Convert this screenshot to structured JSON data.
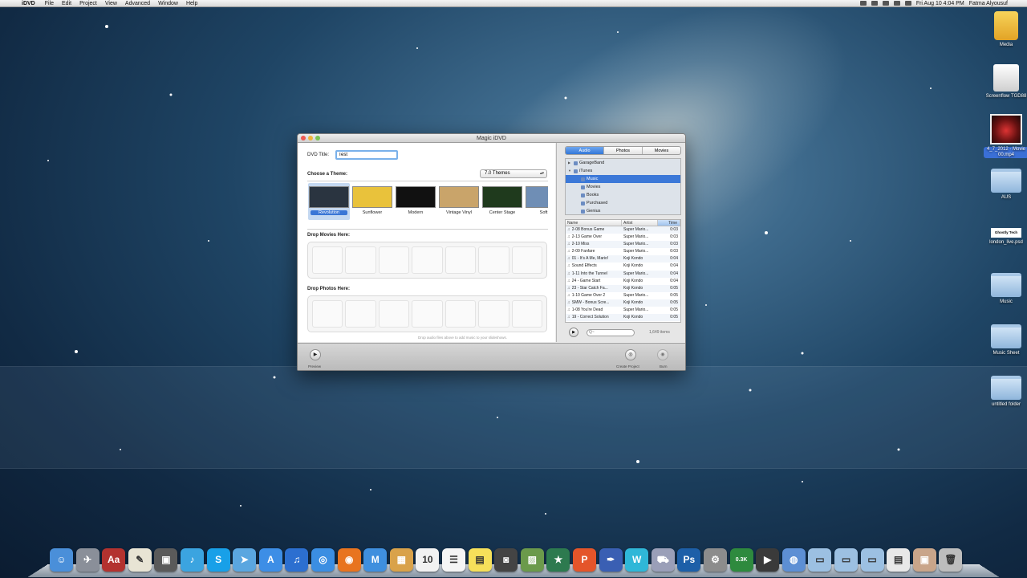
{
  "menubar": {
    "app_name": "iDVD",
    "menus": [
      "File",
      "Edit",
      "Project",
      "View",
      "Advanced",
      "Window",
      "Help"
    ],
    "clock": "Fri Aug 10  4:04 PM",
    "user": "Fatma Alyousuf"
  },
  "window": {
    "title": "Magic iDVD",
    "dvd_title_label": "DVD Title:",
    "dvd_title_value": "Test",
    "choose_theme_label": "Choose a Theme:",
    "themes_family": "7.0 Themes",
    "themes": [
      {
        "name": "Revolution",
        "selected": true,
        "color": "#2a3440"
      },
      {
        "name": "Sunflower",
        "selected": false,
        "color": "#e9c23b"
      },
      {
        "name": "Modern",
        "selected": false,
        "color": "#111111"
      },
      {
        "name": "Vintage Vinyl",
        "selected": false,
        "color": "#c9a46a"
      },
      {
        "name": "Center Stage",
        "selected": false,
        "color": "#1f3a1d"
      },
      {
        "name": "Soft F",
        "selected": false,
        "color": "#6f8eb5"
      }
    ],
    "drop_movies_label": "Drop Movies Here:",
    "drop_photos_label": "Drop Photos Here:",
    "audio_hint": "Drop audio files above to add music to your slideshows.",
    "preview_label": "Preview",
    "create_project_label": "Create Project",
    "burn_label": "Burn",
    "media_tabs": [
      {
        "label": "Audio",
        "active": true
      },
      {
        "label": "Photos",
        "active": false
      },
      {
        "label": "Movies",
        "active": false
      }
    ],
    "sources": [
      {
        "label": "GarageBand",
        "level": 0,
        "disclosure": "▶",
        "selected": false
      },
      {
        "label": "iTunes",
        "level": 0,
        "disclosure": "▼",
        "selected": false
      },
      {
        "label": "Music",
        "level": 1,
        "disclosure": "",
        "selected": true
      },
      {
        "label": "Movies",
        "level": 1,
        "disclosure": "",
        "selected": false
      },
      {
        "label": "Books",
        "level": 1,
        "disclosure": "",
        "selected": false
      },
      {
        "label": "Purchased",
        "level": 1,
        "disclosure": "",
        "selected": false
      },
      {
        "label": "Genius",
        "level": 1,
        "disclosure": "",
        "selected": false
      }
    ],
    "columns": {
      "name": "Name",
      "artist": "Artist",
      "time": "Time"
    },
    "tracks": [
      {
        "name": "2-08 Bonus Game",
        "artist": "Super Mario...",
        "time": "0:03"
      },
      {
        "name": "2-13 Game Over",
        "artist": "Super Mario...",
        "time": "0:03"
      },
      {
        "name": "2-10 Miss",
        "artist": "Super Mario...",
        "time": "0:03"
      },
      {
        "name": "2-09 Fanfare",
        "artist": "Super Mario...",
        "time": "0:03"
      },
      {
        "name": "01 - It's A Me, Mario!",
        "artist": "Koji Kondo",
        "time": "0:04"
      },
      {
        "name": "Sound Effects",
        "artist": "Koji Kondo",
        "time": "0:04"
      },
      {
        "name": "1-11 Into the Tunnel",
        "artist": "Super Mario...",
        "time": "0:04"
      },
      {
        "name": "24 - Game Start",
        "artist": "Koji Kondo",
        "time": "0:04"
      },
      {
        "name": "23 - Star Catch Fa...",
        "artist": "Koji Kondo",
        "time": "0:05"
      },
      {
        "name": "1-10 Game Over 2",
        "artist": "Super Mario...",
        "time": "0:05"
      },
      {
        "name": "SMW - Bonus Scre...",
        "artist": "Koji Kondo",
        "time": "0:05"
      },
      {
        "name": "1-08 You're Dead",
        "artist": "Super Mario...",
        "time": "0:05"
      },
      {
        "name": "19 - Correct Solution",
        "artist": "Koji Kondo",
        "time": "0:05"
      },
      {
        "name": "Sound Effects",
        "artist": "Koji Kondo",
        "time": "0:05"
      }
    ],
    "search_placeholder": "Q~",
    "item_count": "1,649 items"
  },
  "desktop_icons": [
    {
      "label": "Media",
      "kind": "drive-usb",
      "icon": "usb-drive-icon"
    },
    {
      "label": "Screenflow TGD88",
      "kind": "drive-white",
      "icon": "disk-image-icon"
    },
    {
      "label": "4_7_2012 - Movie 00.mp4",
      "kind": "movie-thumb",
      "icon": "movie-file-icon"
    },
    {
      "label": "AUS",
      "kind": "folder",
      "icon": "folder-icon"
    },
    {
      "label": "london_live.psd",
      "kind": "ghost-thumb",
      "icon": "psd-file-icon",
      "thumb_text": "Ghostly Tech"
    },
    {
      "label": "Music",
      "kind": "folder",
      "icon": "folder-icon"
    },
    {
      "label": "Music Sheet",
      "kind": "folder",
      "icon": "folder-icon"
    },
    {
      "label": "untitled folder",
      "kind": "folder",
      "icon": "folder-icon"
    }
  ],
  "dock": [
    {
      "icon": "finder-icon",
      "color": "#4a8fd9",
      "glyph": "☺"
    },
    {
      "icon": "launchpad-icon",
      "color": "#8a8f99",
      "glyph": "✈"
    },
    {
      "icon": "dictionary-icon",
      "color": "#b3322f",
      "glyph": "Aa"
    },
    {
      "icon": "textedit-icon",
      "color": "#e8e4d4",
      "glyph": "✎"
    },
    {
      "icon": "hub-icon",
      "color": "#5a5a5a",
      "glyph": "▣"
    },
    {
      "icon": "twitter-icon",
      "color": "#3ba4e0",
      "glyph": "♪"
    },
    {
      "icon": "skype-icon",
      "color": "#18a0e8",
      "glyph": "S"
    },
    {
      "icon": "cursor-icon",
      "color": "#5aa6e0",
      "glyph": "➤"
    },
    {
      "icon": "app-store-icon",
      "color": "#3d8ee6",
      "glyph": "A"
    },
    {
      "icon": "itunes-icon",
      "color": "#2c6fd0",
      "glyph": "♫"
    },
    {
      "icon": "safari-icon",
      "color": "#3b8ee2",
      "glyph": "◎"
    },
    {
      "icon": "firefox-icon",
      "color": "#e8741f",
      "glyph": "◉"
    },
    {
      "icon": "mail-icon",
      "color": "#3f8fde",
      "glyph": "M"
    },
    {
      "icon": "box-icon",
      "color": "#d9a24a",
      "glyph": "▦"
    },
    {
      "icon": "calendar-icon",
      "color": "#f2f2f2",
      "glyph": "10"
    },
    {
      "icon": "reminders-icon",
      "color": "#f5f5f5",
      "glyph": "☰"
    },
    {
      "icon": "stickies-icon",
      "color": "#f6e05a",
      "glyph": "▤"
    },
    {
      "icon": "photo-booth-icon",
      "color": "#444444",
      "glyph": "◙"
    },
    {
      "icon": "iphoto-icon",
      "color": "#6b9a4b",
      "glyph": "▨"
    },
    {
      "icon": "star-icon",
      "color": "#2d7a4f",
      "glyph": "★"
    },
    {
      "icon": "pages-icon",
      "color": "#e4552a",
      "glyph": "P"
    },
    {
      "icon": "pen-icon",
      "color": "#3a5fb3",
      "glyph": "✒"
    },
    {
      "icon": "dreamweaver-icon",
      "color": "#2fb7d8",
      "glyph": "W"
    },
    {
      "icon": "truck-icon",
      "color": "#9a9fb8",
      "glyph": "⛟"
    },
    {
      "icon": "photoshop-icon",
      "color": "#1d5fa8",
      "glyph": "Ps"
    },
    {
      "icon": "system-preferences-icon",
      "color": "#8c8c8c",
      "glyph": "⚙"
    },
    {
      "icon": "network-monitor-icon",
      "color": "#2e8a3e",
      "glyph": "0.3K"
    },
    {
      "icon": "clapper-icon",
      "color": "#3a3a3a",
      "glyph": "▶"
    },
    {
      "icon": "dvd-icon",
      "color": "#5d8fd4",
      "glyph": "◍"
    },
    {
      "icon": "applications-folder-icon",
      "color": "#9cc0e2",
      "glyph": "▭"
    },
    {
      "icon": "documents-folder-icon",
      "color": "#9cc0e2",
      "glyph": "▭"
    },
    {
      "icon": "downloads-folder-icon",
      "color": "#9cc0e2",
      "glyph": "▭"
    },
    {
      "icon": "document-stack-icon",
      "color": "#e8e8e8",
      "glyph": "▤"
    },
    {
      "icon": "photo-stack-icon",
      "color": "#c9a58a",
      "glyph": "▣"
    },
    {
      "icon": "trash-icon",
      "color": "#bdbdbd",
      "glyph": "🗑"
    }
  ]
}
